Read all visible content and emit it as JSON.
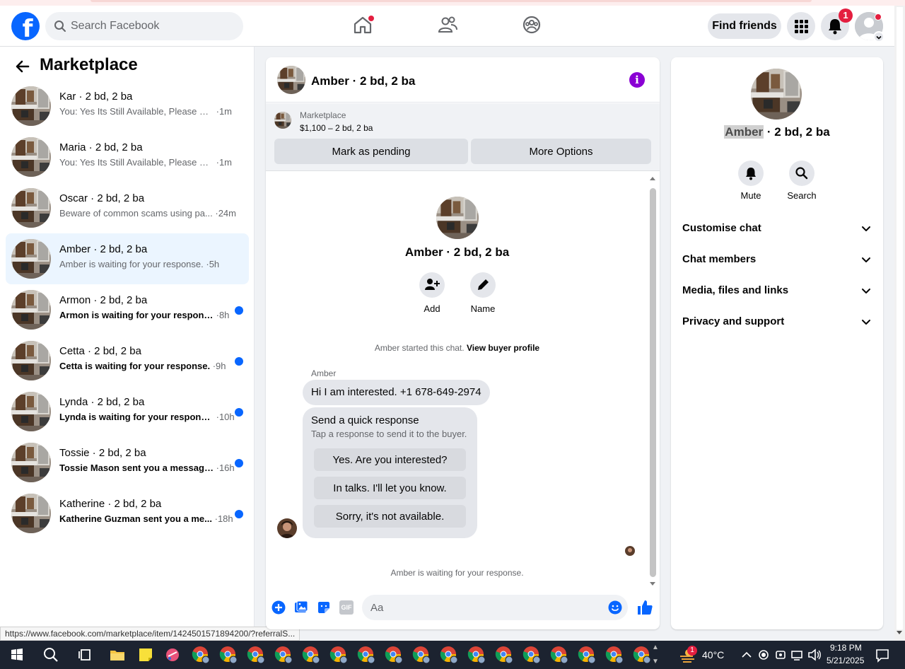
{
  "header": {
    "logo": "f",
    "search_placeholder": "Search Facebook",
    "find_friends": "Find friends",
    "notification_count": "1"
  },
  "sidebar": {
    "title": "Marketplace",
    "conversations": [
      {
        "name": "Kar · 2 bd, 2 ba",
        "preview": "You: Yes Its Still Available, Please Sen...",
        "time": " ·1m",
        "unread": false,
        "active": false
      },
      {
        "name": "Maria · 2 bd, 2 ba",
        "preview": "You: Yes Its Still Available, Please Sen...",
        "time": " ·1m",
        "unread": false,
        "active": false
      },
      {
        "name": "Oscar · 2 bd, 2 ba",
        "preview": "Beware of common scams using pa...",
        "time": " ·24m",
        "unread": false,
        "active": false
      },
      {
        "name": "Amber · 2 bd, 2 ba",
        "preview": "Amber is waiting for your response.",
        "time": " ·5h",
        "unread": false,
        "active": true
      },
      {
        "name": "Armon · 2 bd, 2 ba",
        "preview": "Armon is waiting for your response.",
        "time": " ·8h",
        "unread": true,
        "active": false
      },
      {
        "name": "Cetta · 2 bd, 2 ba",
        "preview": "Cetta is waiting for your response.",
        "time": " ·9h",
        "unread": true,
        "active": false
      },
      {
        "name": "Lynda · 2 bd, 2 ba",
        "preview": "Lynda is waiting for your response.",
        "time": " ·10h",
        "unread": true,
        "active": false
      },
      {
        "name": "Tossie · 2 bd, 2 ba",
        "preview": "Tossie Mason sent you a message...",
        "time": " ·16h",
        "unread": true,
        "active": false
      },
      {
        "name": "Katherine · 2 bd, 2 ba",
        "preview": "Katherine Guzman sent you a me...",
        "time": " ·18h",
        "unread": true,
        "active": false
      }
    ]
  },
  "status_url": "https://www.facebook.com/marketplace/item/1424501571894200/?referralS...",
  "chat": {
    "title": "Amber · 2 bd, 2 ba",
    "info_icon": "i",
    "listing": {
      "category": "Marketplace",
      "price_line": "$1,100 – 2 bd, 2 ba",
      "mark_pending": "Mark as pending",
      "more_options": "More Options"
    },
    "profile_title": "Amber · 2 bd, 2 ba",
    "add_label": "Add",
    "name_label": "Name",
    "started_prefix": "Amber started this chat.",
    "view_buyer": "View buyer profile",
    "sender_name": "Amber",
    "message": "Hi I am interested. +1 678-649-2974",
    "quick": {
      "title": "Send a quick response",
      "subtitle": "Tap a response to send it to the buyer.",
      "options": [
        "Yes. Are you interested?",
        "In talks. I'll let you know.",
        "Sorry, it's not available."
      ]
    },
    "waiting": "Amber is waiting for your response.",
    "composer_placeholder": "Aa",
    "gif_label": "GIF"
  },
  "details": {
    "name_highlight": "Amber",
    "name_rest": " · 2 bd, 2 ba",
    "mute": "Mute",
    "search": "Search",
    "sections": [
      "Customise chat",
      "Chat members",
      "Media, files and links",
      "Privacy and support"
    ]
  },
  "taskbar": {
    "temperature": "40°C",
    "time": "9:18 PM",
    "date": "5/21/2025",
    "weather_badge": "1"
  },
  "colors": {
    "brand": "#0866ff",
    "purple": "#8a00d4",
    "badge": "#e41e3f"
  }
}
